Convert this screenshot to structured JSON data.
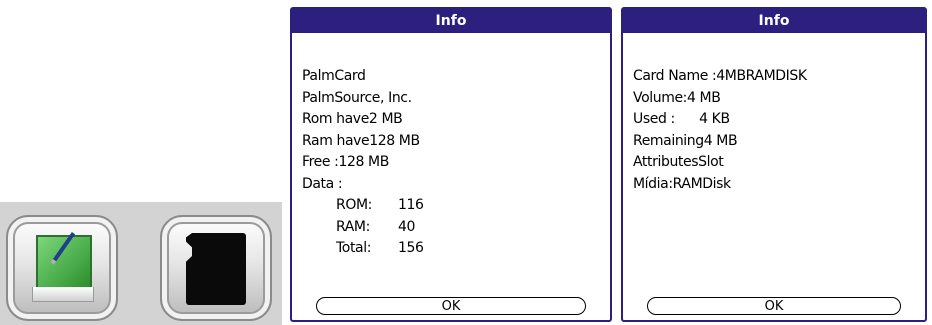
{
  "icons": {
    "left": "palm-handheld-icon",
    "right": "memory-card-icon"
  },
  "info_dialog": {
    "title": "Info",
    "lines": [
      "PalmCard",
      "PalmSource, Inc.",
      "Rom have2 MB",
      "Ram have128 MB",
      "Free :128 MB",
      "Data :"
    ],
    "stats": [
      {
        "label": "ROM:",
        "value": "116"
      },
      {
        "label": "RAM:",
        "value": "40"
      },
      {
        "label": "Total:",
        "value": "156"
      }
    ],
    "ok_label": "OK"
  },
  "card_dialog": {
    "title": "Info",
    "lines": [
      "Card Name :4MBRAMDISK",
      "Volume:4 MB",
      "Used :      4 KB",
      "Remaining4 MB",
      "AttributesSlot",
      "Mídia:RAMDisk"
    ],
    "ok_label": "OK"
  },
  "colors": {
    "title_bar": "#2c1f7e",
    "icon_strip_bg": "#d3d3d3",
    "palm_screen": "#3fae3f"
  }
}
